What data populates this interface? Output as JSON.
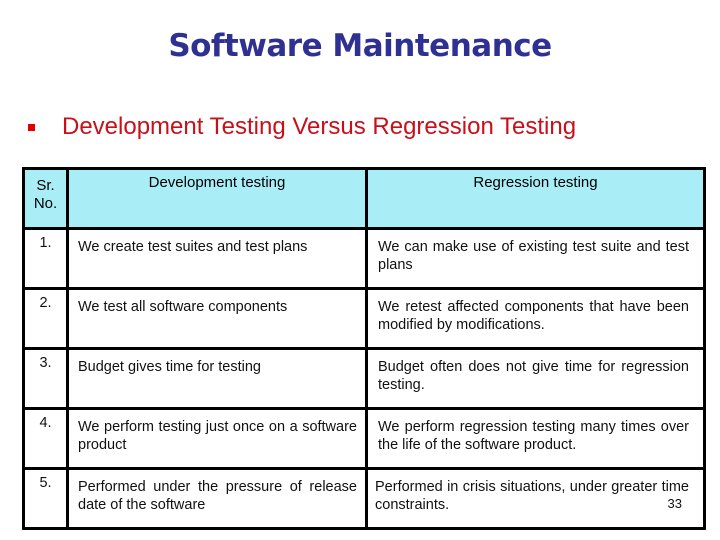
{
  "slide": {
    "title": "Software Maintenance",
    "title_color": "#2e3192",
    "bullet": {
      "icon": "square-bullet-icon",
      "text": "Development Testing Versus Regression Testing",
      "color": "#c8101a"
    },
    "table": {
      "header_bg": "#a9eef7",
      "headers": {
        "sr_line1": "Sr.",
        "sr_line2": "No.",
        "development": "Development testing",
        "regression": "Regression testing"
      },
      "rows": [
        {
          "sr": "1.",
          "development": "We create test suites and test plans",
          "regression": "We can make use of existing test suite and test plans"
        },
        {
          "sr": "2.",
          "development": "We test all software components",
          "regression": "We retest affected components that have been modified by modifications."
        },
        {
          "sr": "3.",
          "development": "Budget gives time for testing",
          "regression": "Budget often does not give time for regression testing."
        },
        {
          "sr": "4.",
          "development": "We perform testing just once on a software product",
          "regression": "We perform regression testing many times over the life of the software product."
        },
        {
          "sr": "5.",
          "development": "Performed under the pressure of release date of the software",
          "regression": "Performed in crisis situations, under greater time constraints."
        }
      ]
    },
    "page_number": "33"
  }
}
